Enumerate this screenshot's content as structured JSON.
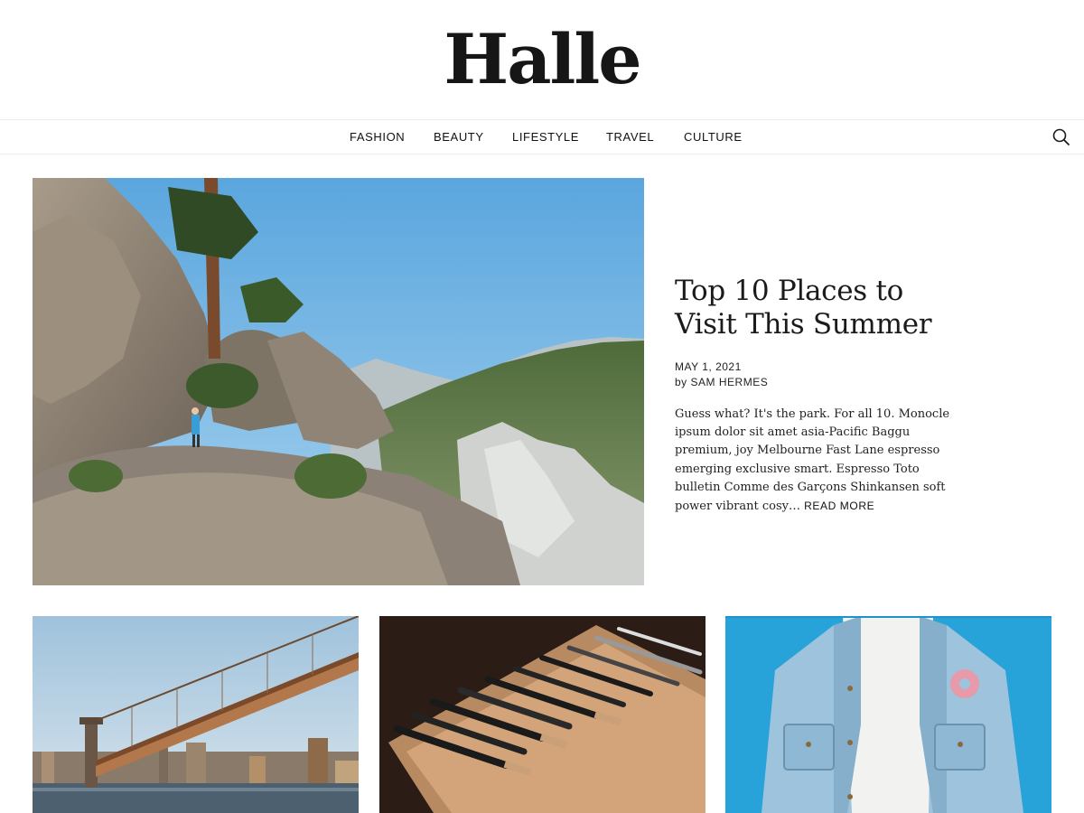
{
  "site": {
    "title": "Halle"
  },
  "nav": {
    "items": [
      {
        "label": "FASHION"
      },
      {
        "label": "BEAUTY"
      },
      {
        "label": "LIFESTYLE"
      },
      {
        "label": "TRAVEL"
      },
      {
        "label": "CULTURE"
      }
    ],
    "search_icon": "search-icon"
  },
  "featured": {
    "title": "Top 10 Places to Visit This Summer",
    "date": "MAY 1, 2021",
    "by": "by",
    "author": "SAM HERMES",
    "excerpt": "Guess what? It's the park. For all 10. Monocle ipsum dolor sit amet asia-Pacific Baggu premium, joy Melbourne Fast Lane espresso emerging exclusive smart. Espresso Toto bulletin Comme des Garçons Shinkansen soft power vibrant cosy…",
    "read_more": "READ MORE",
    "image": "mountain-hiker-photo"
  },
  "cards": [
    {
      "image": "bridge-skyline-photo"
    },
    {
      "image": "makeup-brushes-photo"
    },
    {
      "image": "denim-jacket-photo"
    }
  ],
  "colors": {
    "text": "#1a1a1a",
    "border": "#ececec",
    "background": "#ffffff"
  }
}
